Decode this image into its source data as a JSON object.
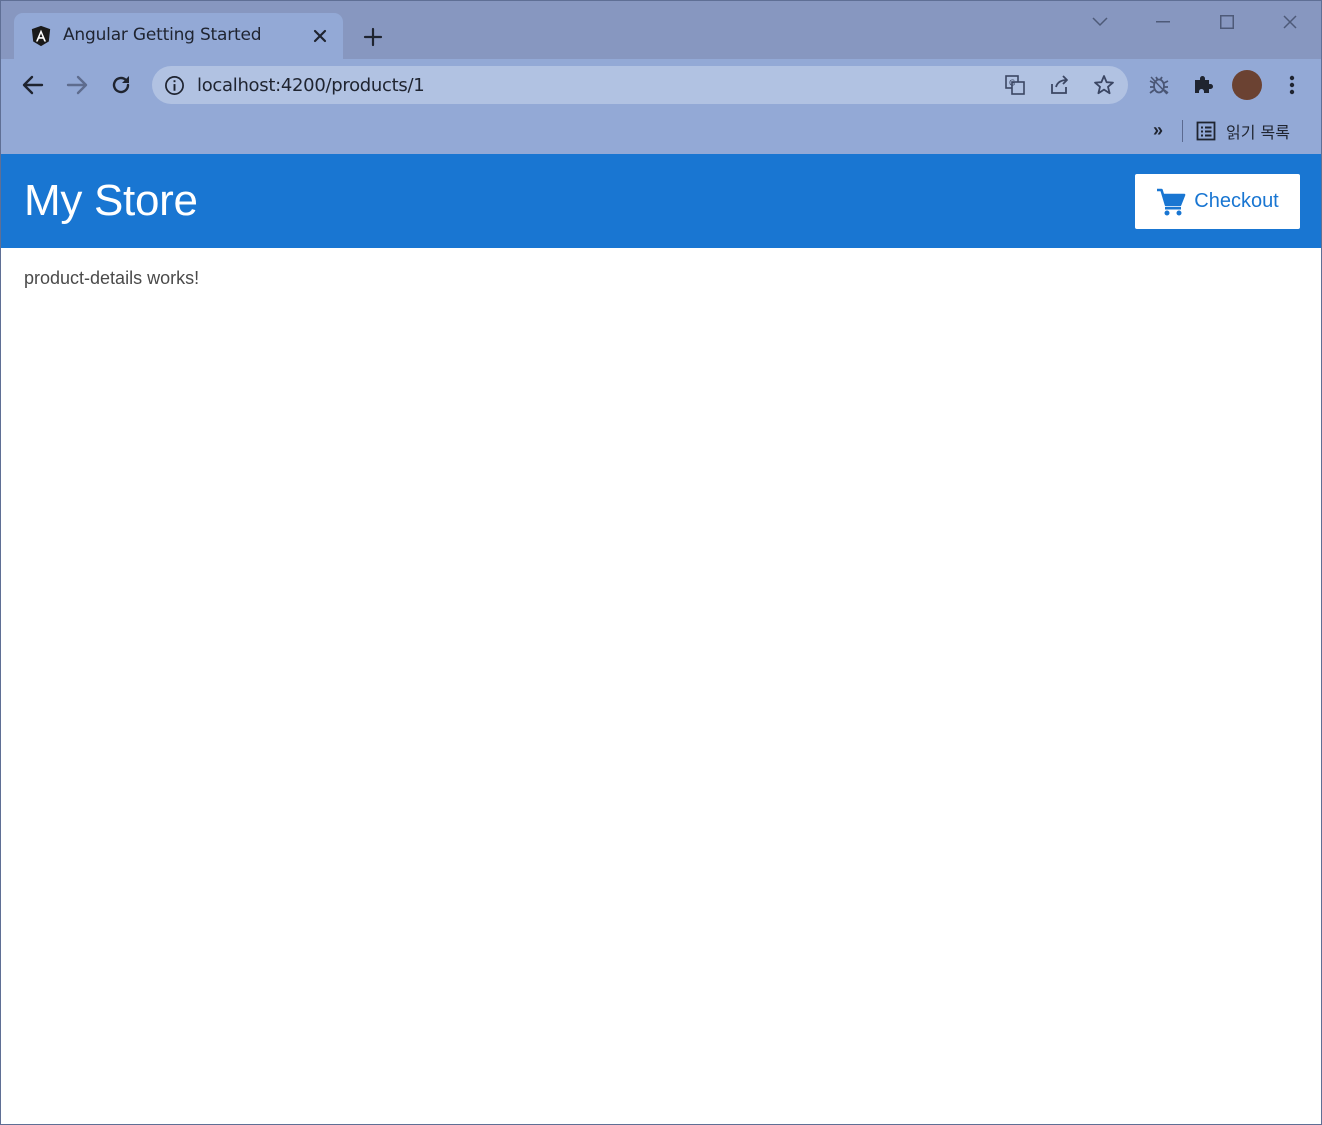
{
  "browser": {
    "tab": {
      "title": "Angular Getting Started"
    },
    "address_bar": {
      "url": "localhost:4200/products/1"
    },
    "bookmarks_bar": {
      "overflow_label": "»",
      "reading_list_label": "읽기 목록"
    },
    "colors": {
      "frame": "#8797c0",
      "toolbar": "#93a9d6",
      "omnibox": "#b1c2e2",
      "avatar": "#6b4232"
    },
    "icons": {
      "tab_favicon": "angular-logo-icon",
      "back": "arrow-left-icon",
      "forward": "arrow-right-icon",
      "reload": "reload-icon",
      "site_info": "info-icon",
      "translate": "translate-icon",
      "share": "share-icon",
      "bookmark": "star-icon",
      "extension_1": "bug-icon",
      "extensions": "puzzle-icon",
      "menu": "kebab-menu-icon",
      "reading_list": "reading-list-icon"
    }
  },
  "app": {
    "title": "My Store",
    "checkout_label": "Checkout",
    "checkout_icon": "shopping-cart-icon",
    "content_text": "product-details works!",
    "colors": {
      "primary": "#1976d2",
      "text": "#4a4a4a"
    }
  }
}
